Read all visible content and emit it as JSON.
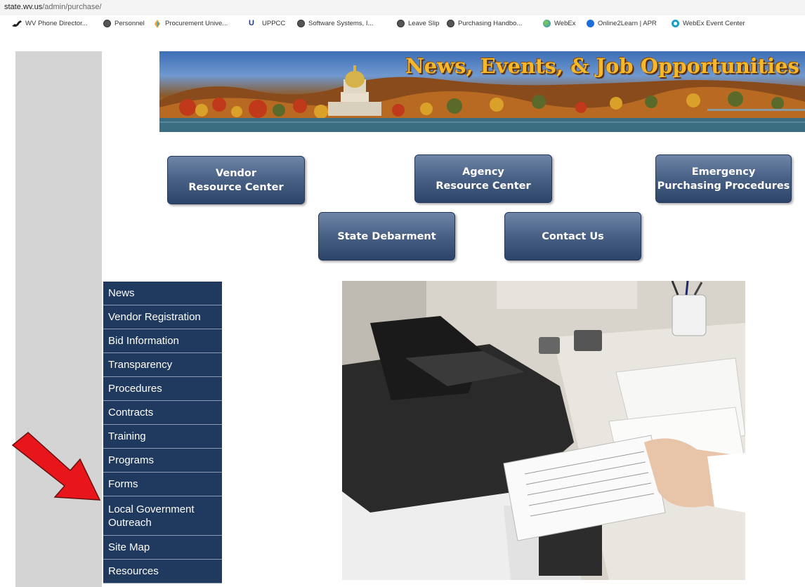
{
  "browser": {
    "url_host": "state.wv.us",
    "url_path": "/admin/purchase/",
    "bookmarks": [
      {
        "label": "WV Phone Director...",
        "icon": "wv-state-icon",
        "color": "#222222"
      },
      {
        "label": "Personnel",
        "icon": "globe-icon",
        "color": "#444444"
      },
      {
        "label": "Procurement Unive...",
        "icon": "procurement-icon",
        "color": "#f0a020"
      },
      {
        "label": "UPPCC",
        "icon": "uppcc-icon",
        "color": "#1a3a8a"
      },
      {
        "label": "Software Systems, I...",
        "icon": "globe-icon",
        "color": "#444444"
      },
      {
        "label": "Leave Slip",
        "icon": "globe-icon",
        "color": "#444444"
      },
      {
        "label": "Purchasing Handbo...",
        "icon": "globe-icon",
        "color": "#444444"
      },
      {
        "label": "WebEx",
        "icon": "webex-icon",
        "color": "#3a9ad9"
      },
      {
        "label": "Online2Learn | APR",
        "icon": "online2learn-icon",
        "color": "#1e6fd9"
      },
      {
        "label": "WebEx Event Center",
        "icon": "webex-icon",
        "color": "#1aa0c8"
      }
    ]
  },
  "banner": {
    "title": "News, Events, & Job Opportunities"
  },
  "nav_buttons": {
    "vendor": "Vendor\nResource Center",
    "agency": "Agency\nResource Center",
    "emergency": "Emergency\nPurchasing Procedures",
    "debarment": "State Debarment",
    "contact": "Contact Us"
  },
  "sidebar": {
    "items": [
      {
        "label": "News"
      },
      {
        "label": "Vendor Registration"
      },
      {
        "label": "Bid Information"
      },
      {
        "label": "Transparency"
      },
      {
        "label": "Procedures"
      },
      {
        "label": "Contracts"
      },
      {
        "label": "Training"
      },
      {
        "label": "Programs"
      },
      {
        "label": "Forms"
      },
      {
        "label": "Local Government Outreach"
      },
      {
        "label": "Site Map"
      },
      {
        "label": "Resources"
      }
    ]
  },
  "colors": {
    "menu_bg": "#1f3a5e",
    "button_gradient_top": "#6f86a8",
    "button_gradient_bottom": "#2d4469",
    "banner_title": "#f5b82a",
    "annotation_arrow": "#e8161b"
  },
  "annotation": {
    "arrow_target": "Forms"
  }
}
